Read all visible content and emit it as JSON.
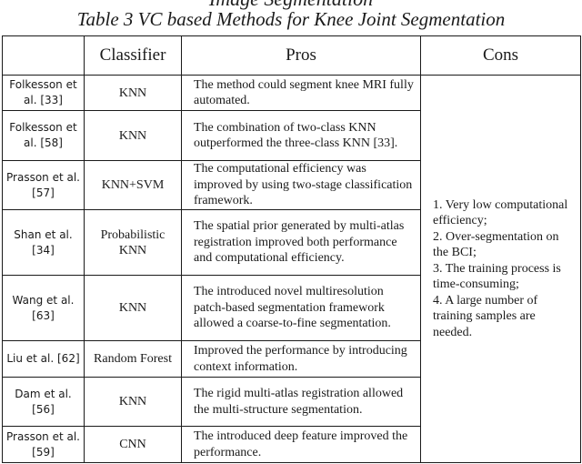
{
  "caption": {
    "clipped_previous_line": "Image Segmentation",
    "title": "Table 3 VC based Methods for Knee Joint Segmentation"
  },
  "table": {
    "headers": [
      "",
      "Classifier",
      "Pros",
      "Cons"
    ],
    "rows": [
      {
        "author": "Folkesson et al. [33]",
        "classifier": "KNN",
        "pros": "The method could segment knee MRI fully automated."
      },
      {
        "author": "Folkesson et al. [58]",
        "classifier": "KNN",
        "pros": "The combination of two-class KNN outperformed the three-class KNN [33]."
      },
      {
        "author": "Prasson et al. [57]",
        "classifier": "KNN+SVM",
        "pros": "The computational efficiency was improved by using two-stage classification framework."
      },
      {
        "author": "Shan et al. [34]",
        "classifier": "Probabilistic KNN",
        "pros": "The spatial prior generated by multi-atlas registration improved both performance and computational efficiency."
      },
      {
        "author": "Wang et al. [63]",
        "classifier": "KNN",
        "pros": "The introduced novel multiresolution patch-based segmentation framework allowed a coarse-to-fine segmentation."
      },
      {
        "author": "Liu et al. [62]",
        "classifier": "Random Forest",
        "pros": "Improved the performance by introducing context information."
      },
      {
        "author": "Dam et al. [56]",
        "classifier": "KNN",
        "pros": "The rigid multi-atlas registration allowed the multi-structure segmentation."
      },
      {
        "author": "Prasson et al. [59]",
        "classifier": "CNN",
        "pros": "The introduced deep feature improved the performance."
      }
    ],
    "cons": [
      "1. Very low computational efficiency;",
      "2. Over-segmentation on the BCI;",
      "3. The training process is time-consuming;",
      "4. A large number of training samples are needed."
    ]
  }
}
